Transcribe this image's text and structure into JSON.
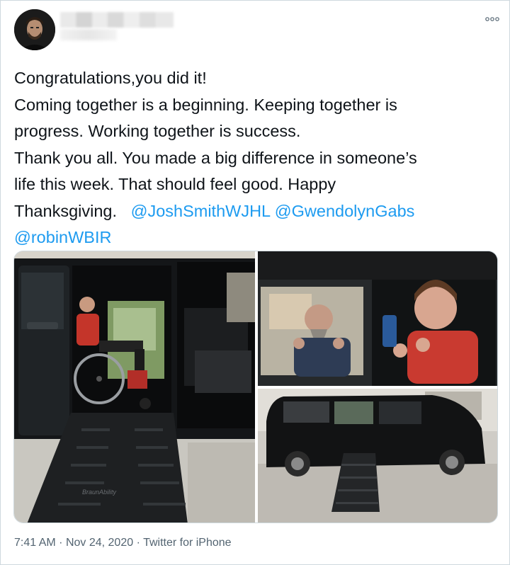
{
  "tweet": {
    "more_icon": "more-dots-icon",
    "lines": [
      "Congratulations,you did it!",
      "Coming together is a beginning. Keeping together is",
      "progress. Working together is success.",
      "Thank you all. You made a big difference in someone’s",
      "life this week. That should feel good. Happy"
    ],
    "last_line_text": "Thanksgiving.",
    "mentions": [
      "@JoshSmithWJHL",
      "@GwendolynGabs",
      "@robinWBIR"
    ],
    "ramp_brand": "BraunAbility",
    "time": "7:41 AM",
    "separator": "·",
    "date": "Nov 24, 2020",
    "source": "Twitter for iPhone"
  },
  "colors": {
    "mention": "#1d9bf0",
    "text": "#0f1419",
    "meta": "#536471"
  }
}
